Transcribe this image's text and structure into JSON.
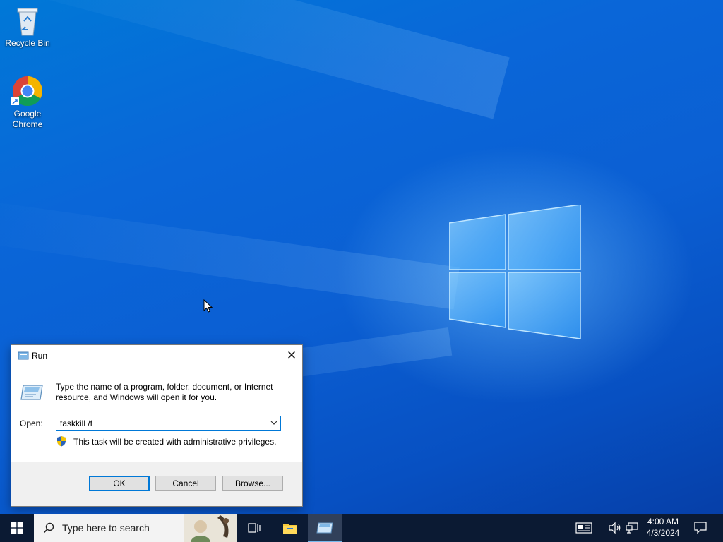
{
  "desktop": {
    "icons": [
      {
        "label": "Recycle Bin",
        "icon": "recycle-bin-icon"
      },
      {
        "label": "Google Chrome",
        "icon": "chrome-icon"
      }
    ]
  },
  "run_dialog": {
    "title": "Run",
    "description": "Type the name of a program, folder, document, or Internet resource, and Windows will open it for you.",
    "open_label": "Open:",
    "open_value": "taskkill /f",
    "privileges_note": "This task will be created with administrative privileges.",
    "buttons": {
      "ok": "OK",
      "cancel": "Cancel",
      "browse": "Browse..."
    }
  },
  "taskbar": {
    "search_placeholder": "Type here to search",
    "pinned": [
      "task-view-icon",
      "file-explorer-icon",
      "run-icon"
    ],
    "time": "4:00 AM",
    "date": "4/3/2024"
  },
  "colors": {
    "desktop_blue": "#0a66d8",
    "taskbar": "#0b1a33",
    "accent": "#0078d7"
  }
}
